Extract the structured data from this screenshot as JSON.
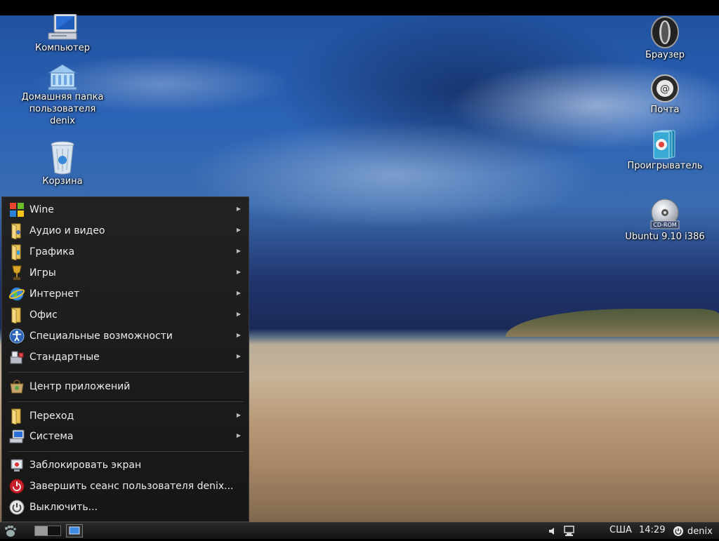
{
  "desktop": {
    "left_icons": [
      {
        "label": "Компьютер",
        "icon": "computer-icon"
      },
      {
        "label": "Домашняя папка пользователя denix",
        "icon": "home-folder-icon"
      },
      {
        "label": "Корзина",
        "icon": "trash-icon"
      }
    ],
    "right_icons": [
      {
        "label": "Браузер",
        "icon": "opera-icon"
      },
      {
        "label": "Почта",
        "icon": "mail-icon"
      },
      {
        "label": "Проигрыватель",
        "icon": "media-player-icon"
      },
      {
        "label": "Ubuntu 9.10 i386",
        "icon": "cdrom-icon",
        "badge": "CD-ROM"
      }
    ]
  },
  "menu": {
    "categories": [
      {
        "label": "Wine",
        "icon": "wine-icon"
      },
      {
        "label": "Аудио и видео",
        "icon": "folder-icon"
      },
      {
        "label": "Графика",
        "icon": "folder-icon"
      },
      {
        "label": "Игры",
        "icon": "games-trophy-icon"
      },
      {
        "label": "Интернет",
        "icon": "internet-globe-icon"
      },
      {
        "label": "Офис",
        "icon": "folder-icon"
      },
      {
        "label": "Специальные возможности",
        "icon": "accessibility-icon"
      },
      {
        "label": "Стандартные",
        "icon": "accessories-icon"
      }
    ],
    "software_center": {
      "label": "Центр приложений",
      "icon": "software-center-icon"
    },
    "places": [
      {
        "label": "Переход",
        "icon": "folder-icon"
      },
      {
        "label": "Система",
        "icon": "system-icon"
      }
    ],
    "session": [
      {
        "label": "Заблокировать экран",
        "icon": "lock-screen-icon"
      },
      {
        "label": "Завершить сеанс пользователя denix...",
        "icon": "logout-icon"
      },
      {
        "label": "Выключить...",
        "icon": "power-icon"
      }
    ]
  },
  "taskbar": {
    "keyboard_layout": "США",
    "clock": "14:29",
    "user": "denix"
  }
}
